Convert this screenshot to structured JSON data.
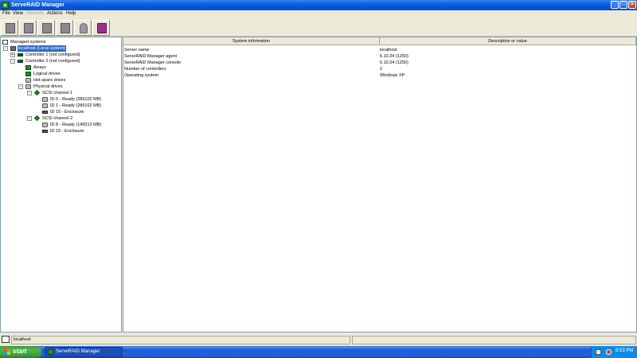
{
  "window": {
    "title": "ServeRAID Manager"
  },
  "menu": [
    {
      "label": "File",
      "enabled": true
    },
    {
      "label": "View",
      "enabled": true
    },
    {
      "label": "Remote",
      "enabled": false
    },
    {
      "label": "Actions",
      "enabled": true
    },
    {
      "label": "Help",
      "enabled": true
    }
  ],
  "toolbar": {
    "buttons": [
      {
        "icon": "add-system-icon"
      },
      {
        "icon": "remove-system-icon"
      },
      {
        "icon": "configure-icon"
      },
      {
        "icon": "properties-icon"
      },
      {
        "icon": "events-bell-icon"
      },
      {
        "icon": "help-book-icon"
      }
    ]
  },
  "tree": {
    "root": "Managed systems",
    "items": [
      {
        "label": "localhost (Local system)",
        "expander": "-"
      },
      {
        "label": "Controller 1 (not configured)",
        "expander": "+"
      },
      {
        "label": "Controller 2 (not configured)",
        "expander": "-"
      },
      {
        "label": "Arrays"
      },
      {
        "label": "Logical drives"
      },
      {
        "label": "Hot-spare drives"
      },
      {
        "label": "Physical drives",
        "expander": "-"
      },
      {
        "label": "SCSI channel 1",
        "expander": "-"
      },
      {
        "label": "ID 0 - Ready (286102 MB)"
      },
      {
        "label": "ID 1 - Ready (286102 MB)"
      },
      {
        "label": "ID 15 - Enclosure"
      },
      {
        "label": "SCSI channel 2",
        "expander": "-"
      },
      {
        "label": "ID 8 - Ready (140013 MB)"
      },
      {
        "label": "ID 15 - Enclosure"
      }
    ]
  },
  "info_table": {
    "headers": [
      "System information",
      "Description or value"
    ],
    "rows": [
      {
        "key": "Server name",
        "value": "localhost"
      },
      {
        "key": "ServeRAID Manager agent",
        "value": "6.10.24 (1250)"
      },
      {
        "key": "ServeRAID Manager console",
        "value": "6.10.24 (1250)"
      },
      {
        "key": "Number of controllers",
        "value": "2"
      },
      {
        "key": "Operating system",
        "value": "Windows XP"
      }
    ]
  },
  "statusbar": {
    "text": "localhost"
  },
  "taskbar": {
    "start_label": "start",
    "app_label": "ServeRAID Manager",
    "clock": "8:53 PM"
  }
}
